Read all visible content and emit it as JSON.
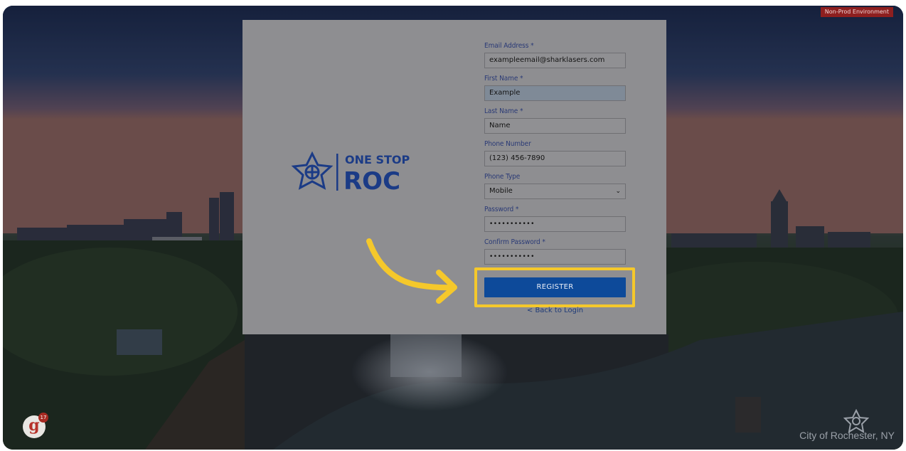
{
  "environment_badge": "Non-Prod Environment",
  "logo": {
    "line1": "ONE STOP",
    "line2": "ROC",
    "brand_color": "#1b3b86"
  },
  "form": {
    "email": {
      "label": "Email Address *",
      "value": "exampleemail@sharklasers.com"
    },
    "first_name": {
      "label": "First Name *",
      "value": "Example"
    },
    "last_name": {
      "label": "Last Name *",
      "value": "Name"
    },
    "phone_number": {
      "label": "Phone Number",
      "value": "(123) 456-7890"
    },
    "phone_type": {
      "label": "Phone Type",
      "value": "Mobile"
    },
    "password": {
      "label": "Password *",
      "value": "•••••••••••"
    },
    "confirm_password": {
      "label": "Confirm Password *",
      "value": "•••••••••••"
    }
  },
  "actions": {
    "register_label": "REGISTER",
    "back_label": "< Back to Login"
  },
  "highlight_color": "#f5c82b",
  "button_color": "#0d4a9a",
  "notification": {
    "letter": "g",
    "count": "17"
  },
  "footer": {
    "city": "City of Rochester, NY"
  }
}
